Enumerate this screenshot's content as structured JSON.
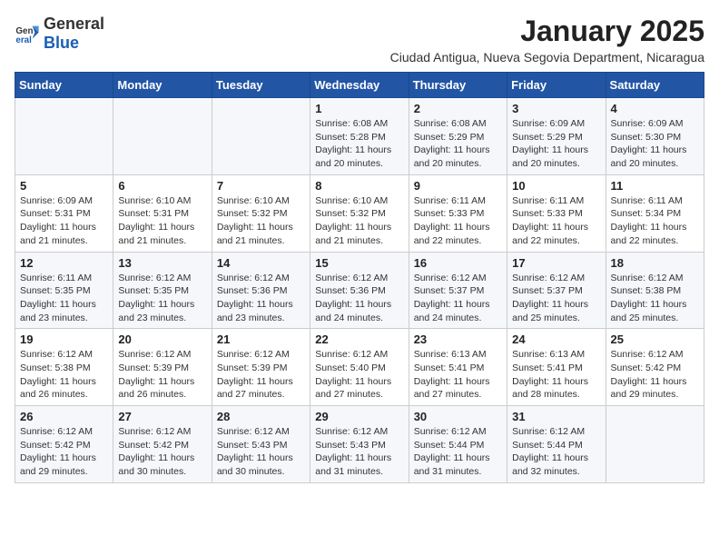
{
  "header": {
    "logo_general": "General",
    "logo_blue": "Blue",
    "month": "January 2025",
    "location": "Ciudad Antigua, Nueva Segovia Department, Nicaragua"
  },
  "weekdays": [
    "Sunday",
    "Monday",
    "Tuesday",
    "Wednesday",
    "Thursday",
    "Friday",
    "Saturday"
  ],
  "weeks": [
    [
      {
        "day": "",
        "info": ""
      },
      {
        "day": "",
        "info": ""
      },
      {
        "day": "",
        "info": ""
      },
      {
        "day": "1",
        "info": "Sunrise: 6:08 AM\nSunset: 5:28 PM\nDaylight: 11 hours and 20 minutes."
      },
      {
        "day": "2",
        "info": "Sunrise: 6:08 AM\nSunset: 5:29 PM\nDaylight: 11 hours and 20 minutes."
      },
      {
        "day": "3",
        "info": "Sunrise: 6:09 AM\nSunset: 5:29 PM\nDaylight: 11 hours and 20 minutes."
      },
      {
        "day": "4",
        "info": "Sunrise: 6:09 AM\nSunset: 5:30 PM\nDaylight: 11 hours and 20 minutes."
      }
    ],
    [
      {
        "day": "5",
        "info": "Sunrise: 6:09 AM\nSunset: 5:31 PM\nDaylight: 11 hours and 21 minutes."
      },
      {
        "day": "6",
        "info": "Sunrise: 6:10 AM\nSunset: 5:31 PM\nDaylight: 11 hours and 21 minutes."
      },
      {
        "day": "7",
        "info": "Sunrise: 6:10 AM\nSunset: 5:32 PM\nDaylight: 11 hours and 21 minutes."
      },
      {
        "day": "8",
        "info": "Sunrise: 6:10 AM\nSunset: 5:32 PM\nDaylight: 11 hours and 21 minutes."
      },
      {
        "day": "9",
        "info": "Sunrise: 6:11 AM\nSunset: 5:33 PM\nDaylight: 11 hours and 22 minutes."
      },
      {
        "day": "10",
        "info": "Sunrise: 6:11 AM\nSunset: 5:33 PM\nDaylight: 11 hours and 22 minutes."
      },
      {
        "day": "11",
        "info": "Sunrise: 6:11 AM\nSunset: 5:34 PM\nDaylight: 11 hours and 22 minutes."
      }
    ],
    [
      {
        "day": "12",
        "info": "Sunrise: 6:11 AM\nSunset: 5:35 PM\nDaylight: 11 hours and 23 minutes."
      },
      {
        "day": "13",
        "info": "Sunrise: 6:12 AM\nSunset: 5:35 PM\nDaylight: 11 hours and 23 minutes."
      },
      {
        "day": "14",
        "info": "Sunrise: 6:12 AM\nSunset: 5:36 PM\nDaylight: 11 hours and 23 minutes."
      },
      {
        "day": "15",
        "info": "Sunrise: 6:12 AM\nSunset: 5:36 PM\nDaylight: 11 hours and 24 minutes."
      },
      {
        "day": "16",
        "info": "Sunrise: 6:12 AM\nSunset: 5:37 PM\nDaylight: 11 hours and 24 minutes."
      },
      {
        "day": "17",
        "info": "Sunrise: 6:12 AM\nSunset: 5:37 PM\nDaylight: 11 hours and 25 minutes."
      },
      {
        "day": "18",
        "info": "Sunrise: 6:12 AM\nSunset: 5:38 PM\nDaylight: 11 hours and 25 minutes."
      }
    ],
    [
      {
        "day": "19",
        "info": "Sunrise: 6:12 AM\nSunset: 5:38 PM\nDaylight: 11 hours and 26 minutes."
      },
      {
        "day": "20",
        "info": "Sunrise: 6:12 AM\nSunset: 5:39 PM\nDaylight: 11 hours and 26 minutes."
      },
      {
        "day": "21",
        "info": "Sunrise: 6:12 AM\nSunset: 5:39 PM\nDaylight: 11 hours and 27 minutes."
      },
      {
        "day": "22",
        "info": "Sunrise: 6:12 AM\nSunset: 5:40 PM\nDaylight: 11 hours and 27 minutes."
      },
      {
        "day": "23",
        "info": "Sunrise: 6:13 AM\nSunset: 5:41 PM\nDaylight: 11 hours and 27 minutes."
      },
      {
        "day": "24",
        "info": "Sunrise: 6:13 AM\nSunset: 5:41 PM\nDaylight: 11 hours and 28 minutes."
      },
      {
        "day": "25",
        "info": "Sunrise: 6:12 AM\nSunset: 5:42 PM\nDaylight: 11 hours and 29 minutes."
      }
    ],
    [
      {
        "day": "26",
        "info": "Sunrise: 6:12 AM\nSunset: 5:42 PM\nDaylight: 11 hours and 29 minutes."
      },
      {
        "day": "27",
        "info": "Sunrise: 6:12 AM\nSunset: 5:42 PM\nDaylight: 11 hours and 30 minutes."
      },
      {
        "day": "28",
        "info": "Sunrise: 6:12 AM\nSunset: 5:43 PM\nDaylight: 11 hours and 30 minutes."
      },
      {
        "day": "29",
        "info": "Sunrise: 6:12 AM\nSunset: 5:43 PM\nDaylight: 11 hours and 31 minutes."
      },
      {
        "day": "30",
        "info": "Sunrise: 6:12 AM\nSunset: 5:44 PM\nDaylight: 11 hours and 31 minutes."
      },
      {
        "day": "31",
        "info": "Sunrise: 6:12 AM\nSunset: 5:44 PM\nDaylight: 11 hours and 32 minutes."
      },
      {
        "day": "",
        "info": ""
      }
    ]
  ]
}
